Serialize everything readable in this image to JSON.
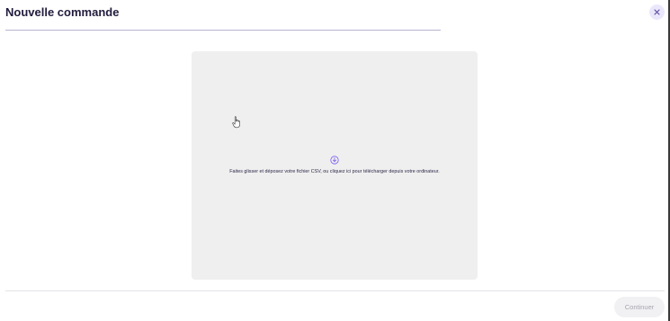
{
  "modal": {
    "title": "Nouvelle commande",
    "close_icon": "close-icon"
  },
  "dropzone": {
    "icon": "upload-icon",
    "text": "Faites glisser et déposez votre fichier CSV, ou cliquez ici pour télécharger depuis votre ordinateur."
  },
  "footer": {
    "continue_label": "Continuer",
    "continue_disabled": true
  },
  "colors": {
    "accent": "#7b5cf0",
    "close_bg": "#ebe7fb",
    "dropzone_bg": "#efefef",
    "disabled_text": "#a7a6b0"
  }
}
